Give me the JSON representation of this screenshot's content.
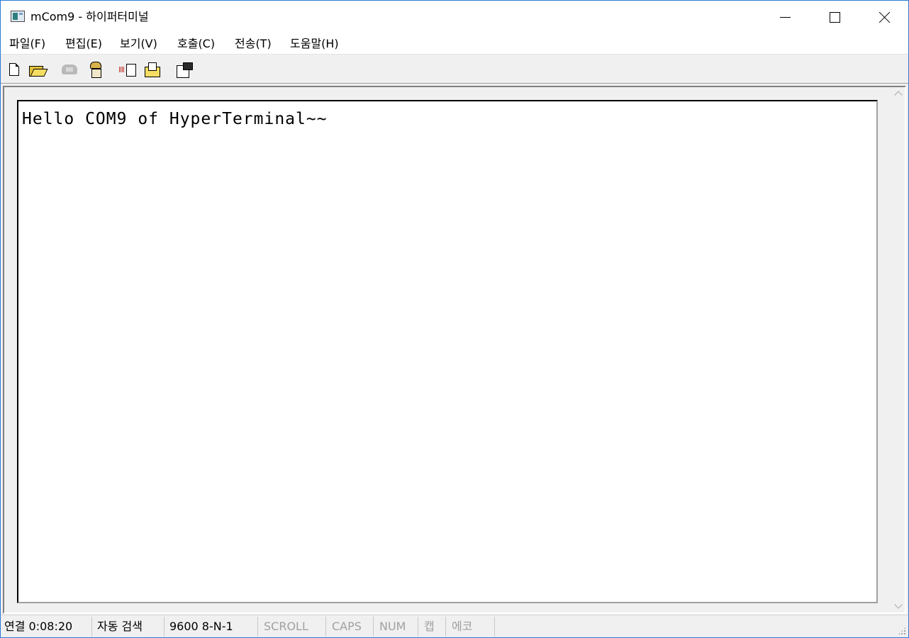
{
  "window": {
    "title": "mCom9 - 하이퍼터미널"
  },
  "menu": [
    {
      "label": "파일(F)"
    },
    {
      "label": "편집(E)"
    },
    {
      "label": "보기(V)"
    },
    {
      "label": "호출(C)"
    },
    {
      "label": "전송(T)"
    },
    {
      "label": "도움말(H)"
    }
  ],
  "toolbar": {
    "icons": [
      "new-icon",
      "open-icon",
      "call-icon",
      "disconnect-icon",
      "send-icon",
      "receive-icon",
      "properties-icon"
    ]
  },
  "terminal": {
    "text": "Hello COM9 of HyperTerminal~~"
  },
  "status": {
    "connection": "연결 0:08:20",
    "detect": "자동 검색",
    "settings": "9600 8-N-1",
    "scroll": "SCROLL",
    "caps": "CAPS",
    "num": "NUM",
    "capture": "캡",
    "echo": "에코"
  }
}
